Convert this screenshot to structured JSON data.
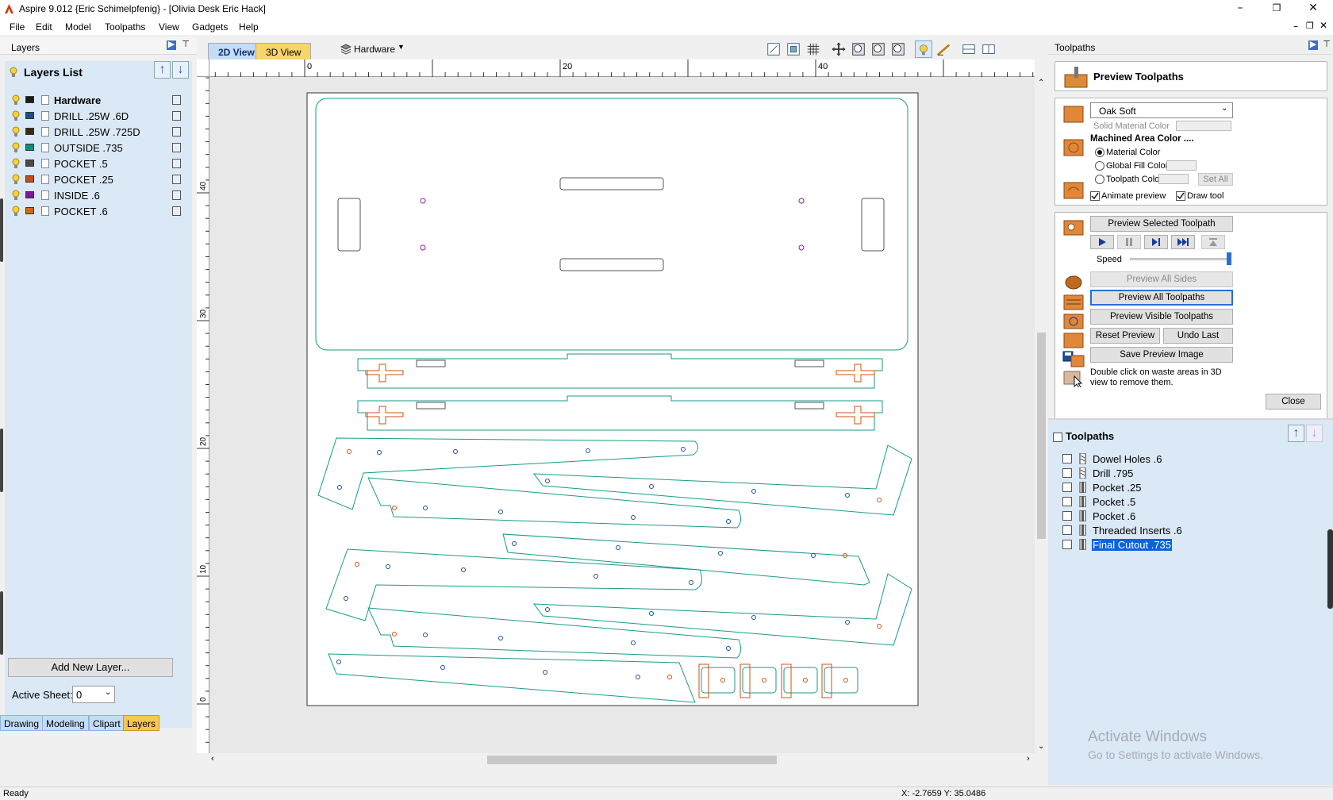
{
  "window": {
    "title": "Aspire 9.012 {Eric Schimelpfenig} - [Olivia Desk Eric Hack]",
    "controls": [
      "–",
      "❐",
      "✕"
    ]
  },
  "menu": [
    "File",
    "Edit",
    "Model",
    "Toolpaths",
    "View",
    "Gadgets",
    "Help"
  ],
  "layers_panel": {
    "title": "Layers",
    "list_title": "Layers List",
    "layers": [
      {
        "name": "Hardware",
        "color": "#1b1b1b",
        "bold": true
      },
      {
        "name": "DRILL .25W .6D",
        "color": "#1a4f8a"
      },
      {
        "name": "DRILL .25W .725D",
        "color": "#3a2a10"
      },
      {
        "name": "OUTSIDE .735",
        "color": "#0a8f7a"
      },
      {
        "name": "POCKET .5",
        "color": "#4a4a4a"
      },
      {
        "name": "POCKET .25",
        "color": "#c0501a"
      },
      {
        "name": "INSIDE .6",
        "color": "#7a1a9a"
      },
      {
        "name": "POCKET .6",
        "color": "#d06a10"
      }
    ],
    "add_button": "Add New Layer...",
    "active_sheet_label": "Active Sheet:",
    "active_sheet_value": "0",
    "bottom_tabs": [
      "Drawing",
      "Modeling",
      "Clipart",
      "Layers"
    ],
    "active_tab": "Layers"
  },
  "view": {
    "tabs": [
      "2D View",
      "3D View"
    ],
    "active_tab": "2D View",
    "layer_dropdown": "Hardware",
    "ruler_top_labels": [
      "0",
      "20",
      "40"
    ],
    "ruler_left_labels": [
      "40",
      "30",
      "20",
      "10",
      "0"
    ]
  },
  "toolpaths_panel": {
    "title": "Toolpaths",
    "preview_title": "Preview Toolpaths",
    "material": "Oak Soft",
    "solid_material_color": "Solid Material Color",
    "machined_area_color": "Machined Area Color ....",
    "radio_options": [
      "Material Color",
      "Global Fill Color",
      "Toolpath Color"
    ],
    "radio_selected": "Material Color",
    "set_all": "Set All",
    "animate_preview": "Animate preview",
    "draw_tool": "Draw tool",
    "preview_selected": "Preview Selected Toolpath",
    "speed_label": "Speed",
    "speed_value": 1.0,
    "preview_all_sides": "Preview All Sides",
    "preview_all_toolpaths": "Preview All Toolpaths",
    "preview_visible_toolpaths": "Preview Visible Toolpaths",
    "reset_preview": "Reset Preview",
    "undo_last": "Undo Last",
    "save_preview_image": "Save Preview Image",
    "hint": "Double click on waste areas in 3D view to remove them.",
    "close": "Close",
    "list_title": "Toolpaths",
    "toolpaths": [
      {
        "name": "Dowel Holes .6",
        "type": "drill",
        "selected": false
      },
      {
        "name": "Drill .795",
        "type": "drill",
        "selected": false
      },
      {
        "name": "Pocket .25",
        "type": "pocket",
        "selected": false
      },
      {
        "name": "Pocket .5",
        "type": "pocket",
        "selected": false
      },
      {
        "name": "Pocket .6",
        "type": "pocket",
        "selected": false
      },
      {
        "name": "Threaded Inserts .6",
        "type": "pocket",
        "selected": false
      },
      {
        "name": "Final Cutout .735",
        "type": "pocket",
        "selected": true
      }
    ]
  },
  "watermark": {
    "line1": "Activate Windows",
    "line2": "Go to Settings to activate Windows."
  },
  "status": {
    "left": "Ready",
    "coords": "X: -2.7659 Y: 35.0486"
  }
}
